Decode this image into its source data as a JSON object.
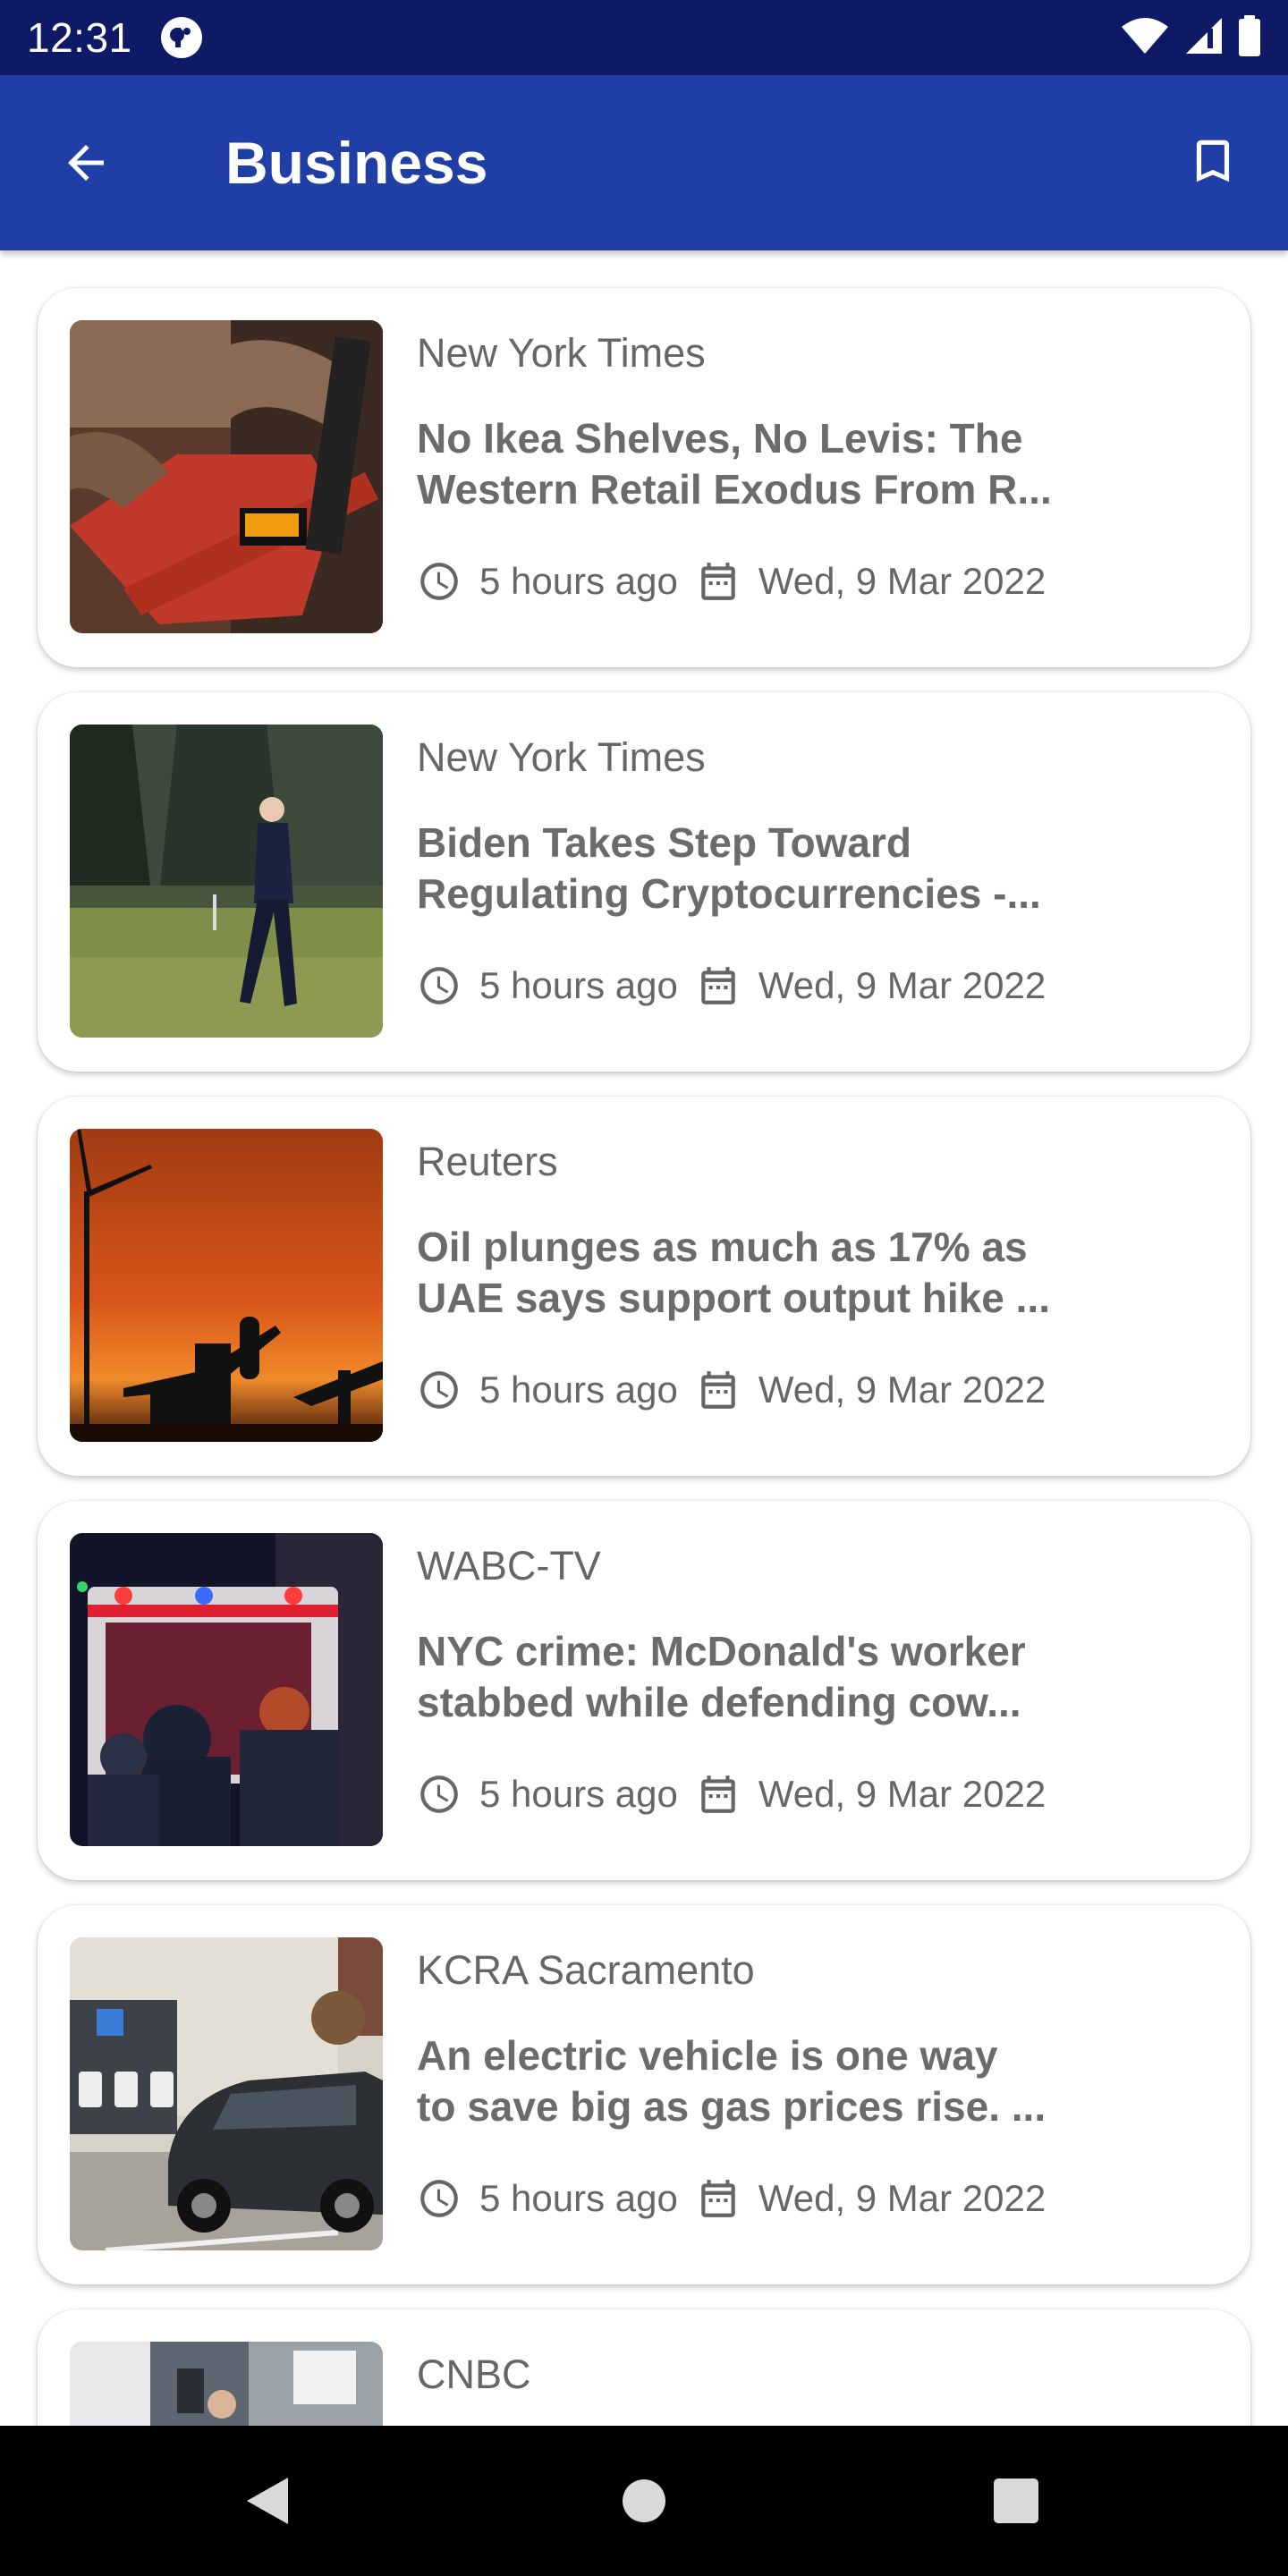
{
  "status_bar": {
    "time": "12:31"
  },
  "app_bar": {
    "title": "Business"
  },
  "articles": [
    {
      "source": "New York Times",
      "headline_line1": "No Ikea Shelves, No Levis: The",
      "headline_line2": "Western Retail Exodus From R...",
      "relative_time": "5 hours ago",
      "date": "Wed, 9 Mar 2022",
      "image": "power-tool-photo"
    },
    {
      "source": "New York Times",
      "headline_line1": "Biden Takes Step Toward",
      "headline_line2": "Regulating Cryptocurrencies -...",
      "relative_time": "5 hours ago",
      "date": "Wed, 9 Mar 2022",
      "image": "man-walking-on-lawn-photo"
    },
    {
      "source": "Reuters",
      "headline_line1": "Oil plunges as much as 17% as",
      "headline_line2": "UAE says support output hike ...",
      "relative_time": "5 hours ago",
      "date": "Wed, 9 Mar 2022",
      "image": "oil-pumpjack-sunset-photo"
    },
    {
      "source": "WABC-TV",
      "headline_line1": "NYC crime: McDonald's worker",
      "headline_line2": "stabbed while defending cow...",
      "relative_time": "5 hours ago",
      "date": "Wed, 9 Mar 2022",
      "image": "ambulance-night-photo"
    },
    {
      "source": "KCRA Sacramento",
      "headline_line1": "An electric vehicle is one way",
      "headline_line2": "to save big as gas prices rise. ...",
      "relative_time": "5 hours ago",
      "date": "Wed, 9 Mar 2022",
      "image": "electric-car-charging-photo"
    },
    {
      "source": "CNBC",
      "headline_line1": "",
      "headline_line2": "",
      "relative_time": "",
      "date": "",
      "image": "hiring-sign-photo"
    }
  ],
  "colors": {
    "status_bar": "#0f1a66",
    "app_bar": "#1f3ea6",
    "nav_bar": "#000000",
    "text_secondary": "#666666"
  }
}
